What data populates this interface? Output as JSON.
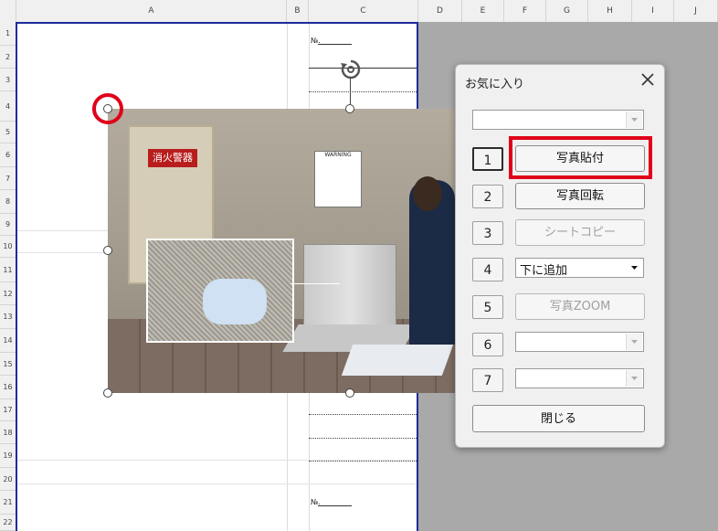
{
  "sheet": {
    "columns": [
      "A",
      "B",
      "C",
      "D",
      "E",
      "F",
      "G",
      "H",
      "I",
      "J"
    ],
    "rows": [
      "1",
      "2",
      "3",
      "4",
      "5",
      "6",
      "7",
      "8",
      "9",
      "10",
      "11",
      "12",
      "13",
      "14",
      "15",
      "16",
      "17",
      "18",
      "19",
      "20",
      "21",
      "22"
    ],
    "no_label_top": "№.",
    "no_label_bottom": "№."
  },
  "picture": {
    "door_sign": "消火警器",
    "warning_sign": "WARNING"
  },
  "dialog": {
    "title": "お気に入り",
    "top_combo_value": "",
    "rows": [
      {
        "num": "1",
        "label": "写真貼付",
        "enabled": true
      },
      {
        "num": "2",
        "label": "写真回転",
        "enabled": true
      },
      {
        "num": "3",
        "label": "シートコピー",
        "enabled": false
      },
      {
        "num": "4",
        "select_value": "下に追加"
      },
      {
        "num": "5",
        "label": "写真ZOOM",
        "enabled": false
      },
      {
        "num": "6",
        "select_value": ""
      },
      {
        "num": "7",
        "select_value": ""
      }
    ],
    "close_label": "閉じる"
  },
  "icons": {
    "close": "close-icon",
    "rotate": "rotate-handle-icon",
    "dropdown": "chevron-down-icon"
  },
  "colors": {
    "highlight": "#e0001a",
    "print_border": "#1f2a9c",
    "dialog_bg": "#f0f0f0"
  }
}
